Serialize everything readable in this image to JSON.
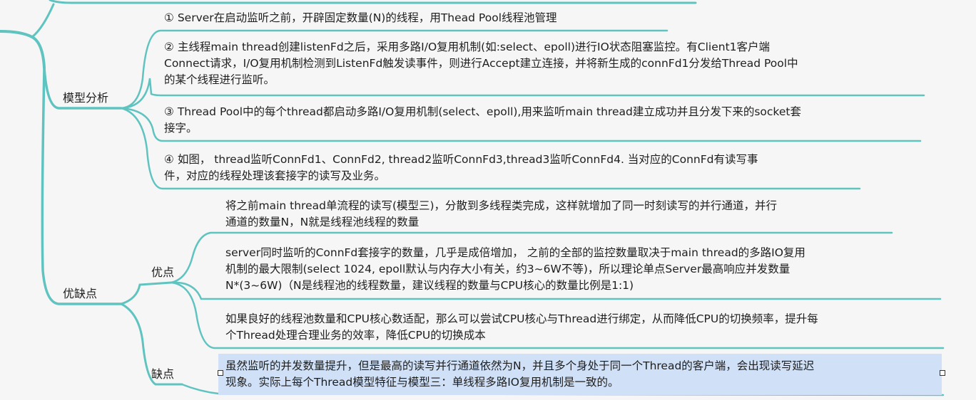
{
  "branches": {
    "model_analysis": "模型分析",
    "pros_cons": "优缺点",
    "pros": "优点",
    "cons": "缺点"
  },
  "analysis": [
    [
      "① Server在启动监听之前，开辟固定数量(N)的线程，用Thead Pool线程池管理"
    ],
    [
      "② 主线程main thread创建listenFd之后，采用多路I/O复用机制(如:select、epoll)进行IO状态阻塞监控。有Client1客户端",
      "Connect请求，I/O复用机制检测到ListenFd触发读事件，则进行Accept建立连接，并将新生成的connFd1分发给Thread Pool中",
      "的某个线程进行监听。"
    ],
    [
      "③ Thread Pool中的每个thread都启动多路I/O复用机制(select、epoll),用来监听main thread建立成功并且分发下来的socket套",
      "接字。"
    ],
    [
      "④ 如图， thread监听ConnFd1、ConnFd2, thread2监听ConnFd3,thread3监听ConnFd4. 当对应的ConnFd有读写事",
      "件，对应的线程处理该套接字的读写及业务。"
    ]
  ],
  "pros_items": [
    [
      "将之前main thread单流程的读写(模型三)，分散到多线程类完成，这样就增加了同一时刻读写的并行通道，并行",
      "通道的数量N，N就是线程池线程的数量"
    ],
    [
      "server同时监听的ConnFd套接字的数量，几乎是成倍增加， 之前的全部的监控数量取决于main thread的多路IO复用",
      "机制的最大限制(select 1024, epoll默认与内存大小有关，约3~6W不等)，所以理论单点Server最高响应并发数量",
      "N*(3~6W)（N是线程池的线程数量，建议线程的数量与CPU核心的数量比例是1:1)"
    ],
    [
      "如果良好的线程池数量和CPU核心数适配，那么可以尝试CPU核心与Thread进行绑定，从而降低CPU的切换频率，提升每",
      "个Thread处理合理业务的效率，降低CPU的切换成本"
    ]
  ],
  "cons_items": [
    [
      "虽然监听的并发数量提升，但是最高的读写并行通道依然为N，并且多个身处于同一个Thread的客户端，会出现读写延迟",
      "现象。实际上每个Thread模型特征与模型三：单线程多路IO复用机制是一致的。"
    ]
  ],
  "colors": {
    "branch": "#5fc3c0",
    "highlight": "#cfe0f7"
  }
}
